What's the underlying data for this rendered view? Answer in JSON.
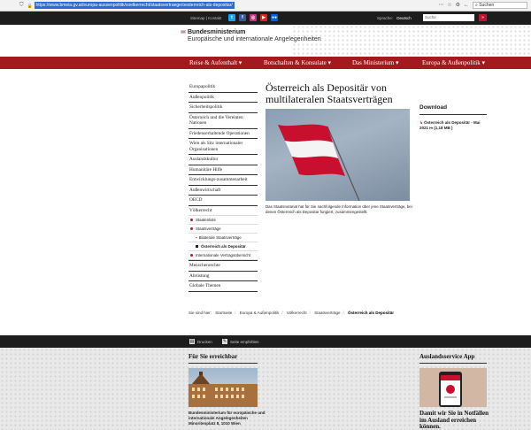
{
  "browser": {
    "url": "https://www.bmeia.gv.at/europa-aussenpolitik/voelkerrecht/staatsvertraege/oesterreich-als-depositar/",
    "search_placeholder": "Suchen"
  },
  "topbar": {
    "links": "Sitemap | Kontakt",
    "language_label": "Sprache:",
    "language_value": "Deutsch",
    "search_placeholder": "Suche",
    "search_button": "»",
    "social": [
      {
        "name": "twitter-icon",
        "glyph": "t",
        "color": "#1da1f2"
      },
      {
        "name": "facebook-icon",
        "glyph": "f",
        "color": "#3b5998"
      },
      {
        "name": "instagram-icon",
        "glyph": "◎",
        "color": "#c13584"
      },
      {
        "name": "youtube-icon",
        "glyph": "▶",
        "color": "#e62117"
      },
      {
        "name": "flickr-icon",
        "glyph": "●●",
        "color": "#0063dc"
      }
    ]
  },
  "header": {
    "org_line1": "Bundesministerium",
    "org_line2": "Europäische und internationale Angelegenheiten"
  },
  "nav": [
    {
      "label": "Reise & Aufenthalt ▾"
    },
    {
      "label": "Botschaften & Konsulate ▾"
    },
    {
      "label": "Das Ministerium ▾"
    },
    {
      "label": "Europa & Außenpolitik ▾"
    }
  ],
  "sidebar": {
    "items": [
      "Europapolitik",
      "Außenpolitik",
      "Sicherheitspolitik",
      "Österreich und die Vereinten Nationen",
      "Friedenserhaltende Operationen",
      "Wien als Sitz internationaler Organisationen",
      "Auslandskultur",
      "Humanitäre Hilfe",
      "Entwicklungs-zusammenarbeit",
      "Außenwirtschaft",
      "OECD",
      "Völkerrecht"
    ],
    "sub": {
      "staatenliste": "Staatenliste",
      "staatsvertraege": "Staatsverträge",
      "bilaterale": "Bilaterale Staatsverträge",
      "depositar": "Österreich als Depositär",
      "internationale": "Internationale Vertragsübersicht"
    },
    "after": [
      "Menschenrechte",
      "Abrüstung",
      "Globale Themen"
    ]
  },
  "main": {
    "title": "Österreich als Depositär von multilateralen Staatsverträgen",
    "caption": "Das Staatsnotariat hat für Sie nachfolgende Information über jene Staatsverträge, bei denen Österreich als Depositar fungiert, zusammengestellt."
  },
  "download": {
    "heading": "Download",
    "link": "Österreich als Depositär - Mai 2021 ↦ (1,18 MB )"
  },
  "breadcrumb": {
    "label": "Sie sind hier:",
    "items": [
      "Startseite",
      "Europa & Außenpolitik",
      "Völkerrecht",
      "Staatsverträge"
    ],
    "current": "Österreich als Depositär"
  },
  "toolbar": {
    "print": "Drucken",
    "recommend": "Seite empfehlen"
  },
  "footer": {
    "contact_heading": "Für Sie erreichbar",
    "contact_text": "Bundesministerium für europäische und internationale Angelegenheiten Minoritenplatz 8, 1010 Wien",
    "app_heading": "Auslandsservice App",
    "app_text": "Damit wir Sie in Notfällen im Ausland erreichen können."
  },
  "colors": {
    "brand_red": "#a3191d",
    "accent_red": "#c8102e",
    "dark": "#1d1d1d"
  }
}
